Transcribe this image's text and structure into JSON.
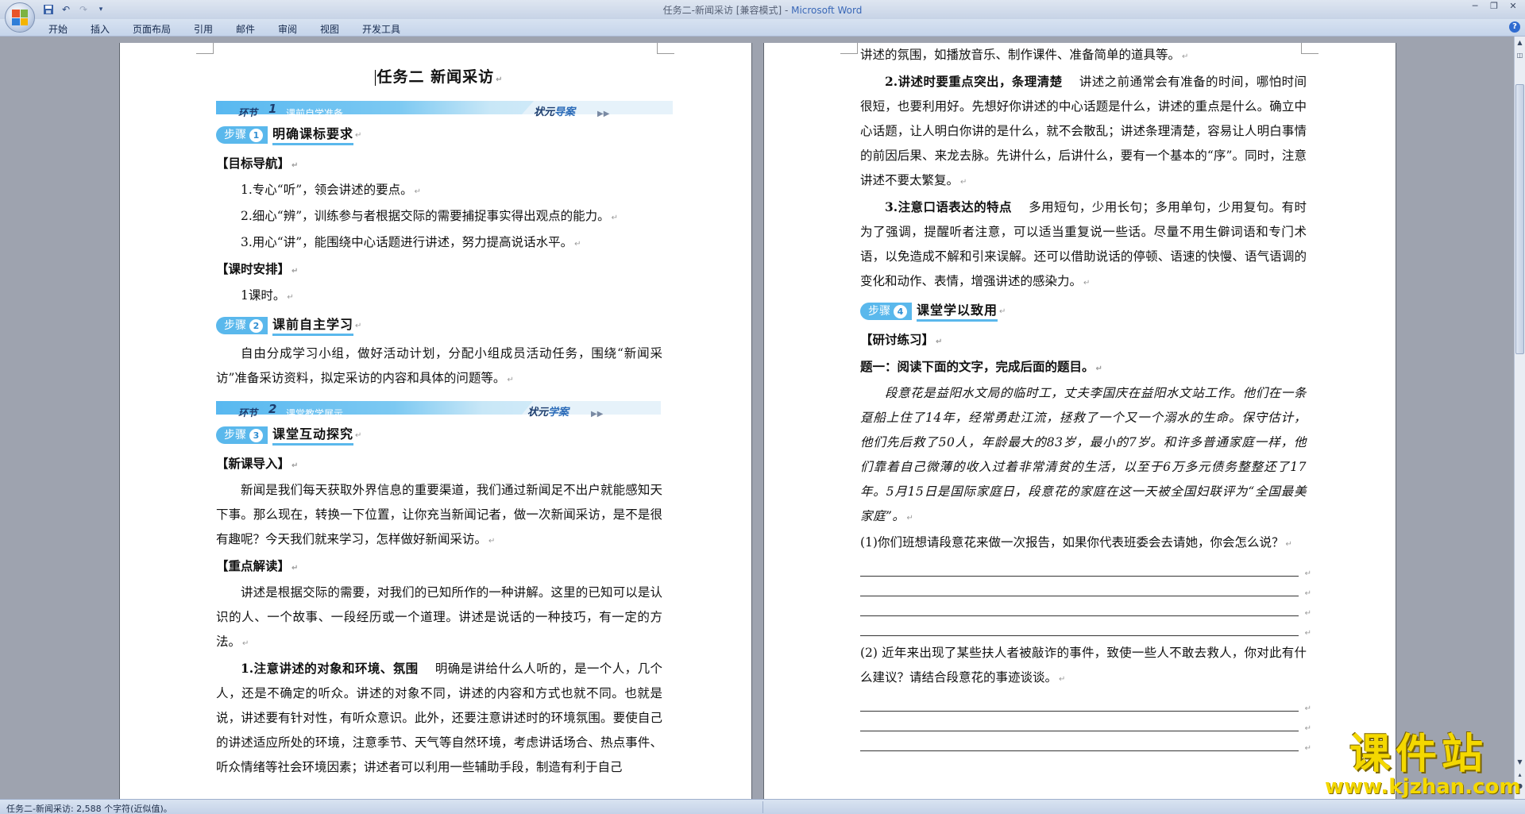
{
  "window": {
    "title": "任务二-新闻采访 [兼容模式] - ",
    "app_name": "Microsoft Word"
  },
  "qat": {
    "save_icon": "save-icon",
    "undo_icon": "undo-icon",
    "redo_icon": "redo-icon",
    "customize_icon": "dropdown-icon"
  },
  "tabs": [
    "开始",
    "插入",
    "页面布局",
    "引用",
    "邮件",
    "审阅",
    "视图",
    "开发工具"
  ],
  "page1": {
    "title": "任务二  新闻采访",
    "section1": {
      "env": "环节",
      "num": "1",
      "sub": "课前自学准备",
      "right_a": "状元",
      "right_b": "导案"
    },
    "step1": {
      "label": "步骤",
      "num": "1",
      "title": "明确课标要求"
    },
    "goal_heading": "【目标导航】",
    "goals": [
      "1.专心“听”，领会讲述的要点。",
      "2.细心“辨”，训练参与者根据交际的需要捕捉事实得出观点的能力。",
      "3.用心“讲”，能围绕中心话题进行讲述，努力提高说话水平。"
    ],
    "schedule_heading": "【课时安排】",
    "schedule": "1课时。",
    "step2": {
      "label": "步骤",
      "num": "2",
      "title": "课前自主学习"
    },
    "step2_text": "自由分成学习小组，做好活动计划，分配小组成员活动任务，围绕“新闻采访”准备采访资料，拟定采访的内容和具体的问题等。",
    "section2": {
      "env": "环节",
      "num": "2",
      "sub": "课堂教学展示",
      "right_a": "状元",
      "right_b": "学案"
    },
    "step3": {
      "label": "步骤",
      "num": "3",
      "title": "课堂互动探究"
    },
    "intro_heading": "【新课导入】",
    "intro_text": "新闻是我们每天获取外界信息的重要渠道，我们通过新闻足不出户就能感知天下事。那么现在，转换一下位置，让你充当新闻记者，做一次新闻采访，是不是很有趣呢？今天我们就来学习，怎样做好新闻采访。",
    "focus_heading": "【重点解读】",
    "focus_text": "讲述是根据交际的需要，对我们的已知所作的一种讲解。这里的已知可以是认识的人、一个故事、一段经历或一个道理。讲述是说话的一种技巧，有一定的方法。",
    "point1_title": "1.注意讲述的对象和环境、氛围",
    "point1_text": "明确是讲给什么人听的，是一个人，几个人，还是不确定的听众。讲述的对象不同，讲述的内容和方式也就不同。也就是说，讲述要有针对性，有听众意识。此外，还要注意讲述时的环境氛围。要使自己的讲述适应所处的环境，注意季节、天气等自然环境，考虑讲话场合、热点事件、听众情绪等社会环境因素；讲述者可以利用一些辅助手段，制造有利于自己"
  },
  "page2": {
    "cont_text": "讲述的氛围，如播放音乐、制作课件、准备简单的道具等。",
    "point2_title": "2.讲述时要重点突出，条理清楚",
    "point2_text": "讲述之前通常会有准备的时间，哪怕时间很短，也要利用好。先想好你讲述的中心话题是什么，讲述的重点是什么。确立中心话题，让人明白你讲的是什么，就不会散乱；讲述条理清楚，容易让人明白事情的前因后果、来龙去脉。先讲什么，后讲什么，要有一个基本的“序”。同时，注意讲述不要太繁复。",
    "point3_title": "3.注意口语表达的特点",
    "point3_text": "多用短句，少用长句；多用单句，少用复句。有时为了强调，提醒听者注意，可以适当重复说一些话。尽量不用生僻词语和专门术语，以免造成不解和引来误解。还可以借助说话的停顿、语速的快慢、语气语调的变化和动作、表情，增强讲述的感染力。",
    "step4": {
      "label": "步骤",
      "num": "4",
      "title": "课堂学以致用"
    },
    "practice_heading": "【研讨练习】",
    "q1_heading": "题一：阅读下面的文字，完成后面的题目。",
    "passage": "段意花是益阳水文局的临时工，丈夫李国庆在益阳水文站工作。他们在一条趸船上住了14年，经常勇赴江流，拯救了一个又一个溺水的生命。保守估计，他们先后救了50人，年龄最大的83岁，最小的7岁。和许多普通家庭一样，他们靠着自己微薄的收入过着非常清贫的生活，以至于6万多元债务整整还了17年。5月15日是国际家庭日，段意花的家庭在这一天被全国妇联评为“全国最美家庭”。",
    "q1": "(1)你们班想请段意花来做一次报告，如果你代表班委会去请她，你会怎么说？",
    "q2": "(2) 近年来出现了某些扶人者被敲诈的事件，致使一些人不敢去救人，你对此有什么建议？请结合段意花的事迹谈谈。"
  },
  "status": {
    "text": "任务二-新闻采访: 2,588 个字符(近似值)。"
  },
  "watermark": {
    "title": "课件站",
    "url": "www.kjzhan.com"
  }
}
